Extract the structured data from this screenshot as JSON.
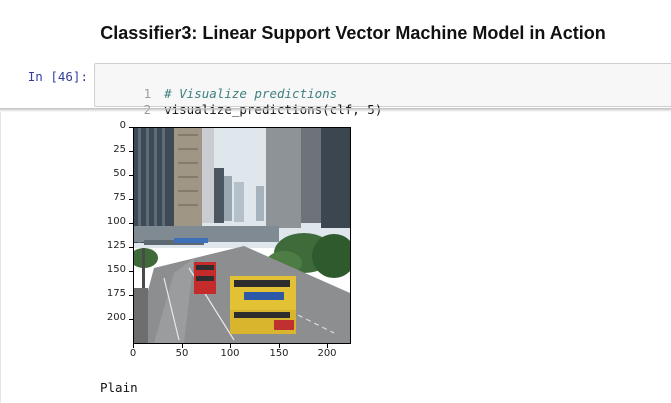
{
  "page": {
    "title": "Classifier3: Linear Support Vector Machine Model in Action"
  },
  "cell": {
    "prompt": "In [46]:",
    "lines": [
      {
        "number": "1",
        "text": "# Visualize predictions",
        "kind": "comment"
      },
      {
        "number": "2",
        "text": "visualize_predictions(clf, 5)",
        "kind": "code"
      }
    ]
  },
  "output": {
    "image_description_icon": "city-street-buses-image",
    "y_ticks": [
      "0",
      "25",
      "50",
      "75",
      "100",
      "125",
      "150",
      "175",
      "200"
    ],
    "x_ticks": [
      "0",
      "50",
      "100",
      "150",
      "200"
    ],
    "axis_extent": {
      "x": [
        0,
        224
      ],
      "y": [
        0,
        224
      ]
    },
    "prediction": "Plain"
  },
  "colors": {
    "prompt": "#303f9f",
    "comment": "#408080",
    "cell_background": "#f7f7f7"
  }
}
